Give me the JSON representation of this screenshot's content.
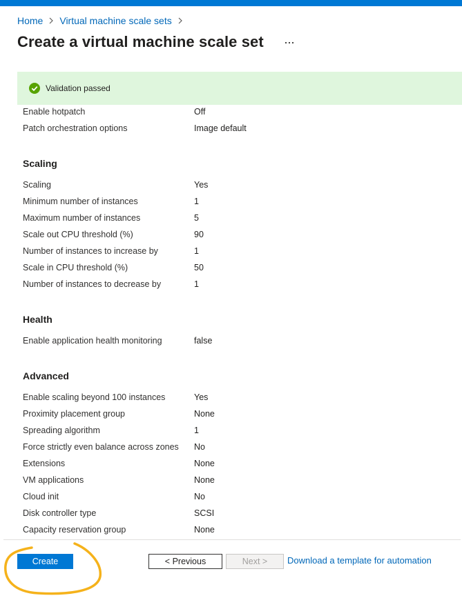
{
  "breadcrumb": {
    "home": "Home",
    "vmss": "Virtual machine scale sets"
  },
  "page": {
    "title": "Create a virtual machine scale set",
    "more": "..."
  },
  "validation": {
    "text": "Validation passed",
    "color": "#dff6dd",
    "icon": "check-circle-icon",
    "icon_color": "#57a300"
  },
  "patching": [
    {
      "label": "Enable hotpatch",
      "value": "Off"
    },
    {
      "label": "Patch orchestration options",
      "value": "Image default"
    }
  ],
  "scaling": {
    "heading": "Scaling",
    "rows": [
      {
        "label": "Scaling",
        "value": "Yes"
      },
      {
        "label": "Minimum number of instances",
        "value": "1"
      },
      {
        "label": "Maximum number of instances",
        "value": "5"
      },
      {
        "label": "Scale out CPU threshold (%)",
        "value": "90"
      },
      {
        "label": "Number of instances to increase by",
        "value": "1"
      },
      {
        "label": "Scale in CPU threshold (%)",
        "value": "50"
      },
      {
        "label": "Number of instances to decrease by",
        "value": "1"
      }
    ]
  },
  "health": {
    "heading": "Health",
    "rows": [
      {
        "label": "Enable application health monitoring",
        "value": "false"
      }
    ]
  },
  "advanced": {
    "heading": "Advanced",
    "rows": [
      {
        "label": "Enable scaling beyond 100 instances",
        "value": "Yes"
      },
      {
        "label": "Proximity placement group",
        "value": "None"
      },
      {
        "label": "Spreading algorithm",
        "value": "1"
      },
      {
        "label": "Force strictly even balance across zones",
        "value": "No"
      },
      {
        "label": "Extensions",
        "value": "None"
      },
      {
        "label": "VM applications",
        "value": "None"
      },
      {
        "label": "Cloud init",
        "value": "No"
      },
      {
        "label": "Disk controller type",
        "value": "SCSI"
      },
      {
        "label": "Capacity reservation group",
        "value": "None"
      }
    ]
  },
  "footer": {
    "create": "Create",
    "previous": "< Previous",
    "next": "Next >",
    "download": "Download a template for automation"
  },
  "colors": {
    "accent": "#0078d4",
    "link": "#0067b8",
    "annotation": "#f5b21b"
  }
}
